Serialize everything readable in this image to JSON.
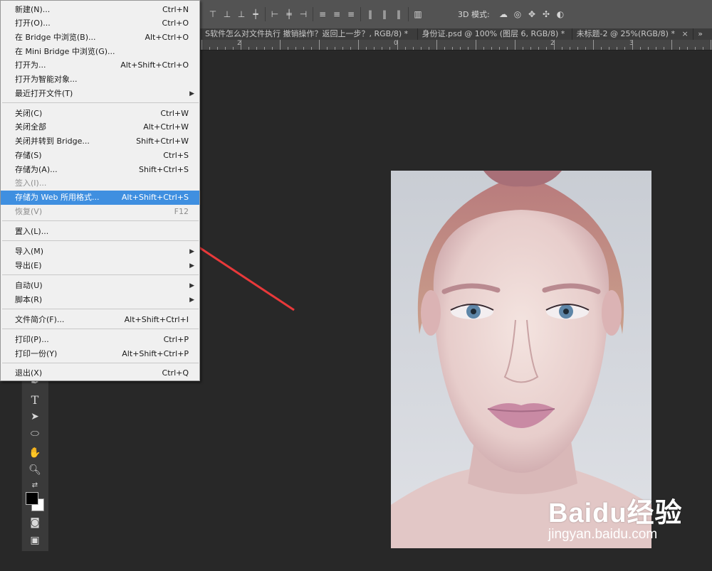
{
  "options_bar": {
    "label_3d": "3D 模式:"
  },
  "tabs": [
    {
      "label": "S软件怎么对文件执行 撤销操作？返回上一步？, RGB/8) *"
    },
    {
      "label": "身份证.psd @ 100% (图层 6, RGB/8) *"
    },
    {
      "label": "未标题-2 @ 25%(RGB/8) *"
    }
  ],
  "ruler": {
    "marks": [
      "2",
      "0",
      "2",
      "3"
    ]
  },
  "menu": {
    "items": [
      {
        "label": "新建(N)...",
        "shortcut": "Ctrl+N"
      },
      {
        "label": "打开(O)...",
        "shortcut": "Ctrl+O"
      },
      {
        "label": "在 Bridge 中浏览(B)...",
        "shortcut": "Alt+Ctrl+O"
      },
      {
        "label": "在 Mini Bridge 中浏览(G)...",
        "shortcut": ""
      },
      {
        "label": "打开为...",
        "shortcut": "Alt+Shift+Ctrl+O"
      },
      {
        "label": "打开为智能对象...",
        "shortcut": ""
      },
      {
        "label": "最近打开文件(T)",
        "shortcut": ""
      },
      {
        "label": "关闭(C)",
        "shortcut": "Ctrl+W"
      },
      {
        "label": "关闭全部",
        "shortcut": "Alt+Ctrl+W"
      },
      {
        "label": "关闭并转到 Bridge...",
        "shortcut": "Shift+Ctrl+W"
      },
      {
        "label": "存储(S)",
        "shortcut": "Ctrl+S"
      },
      {
        "label": "存储为(A)...",
        "shortcut": "Shift+Ctrl+S"
      },
      {
        "label": "签入(I)...",
        "shortcut": ""
      },
      {
        "label": "存储为 Web 所用格式...",
        "shortcut": "Alt+Shift+Ctrl+S"
      },
      {
        "label": "恢复(V)",
        "shortcut": "F12"
      },
      {
        "label": "置入(L)...",
        "shortcut": ""
      },
      {
        "label": "导入(M)",
        "shortcut": ""
      },
      {
        "label": "导出(E)",
        "shortcut": ""
      },
      {
        "label": "自动(U)",
        "shortcut": ""
      },
      {
        "label": "脚本(R)",
        "shortcut": ""
      },
      {
        "label": "文件简介(F)...",
        "shortcut": "Alt+Shift+Ctrl+I"
      },
      {
        "label": "打印(P)...",
        "shortcut": "Ctrl+P"
      },
      {
        "label": "打印一份(Y)",
        "shortcut": "Alt+Shift+Ctrl+P"
      },
      {
        "label": "退出(X)",
        "shortcut": "Ctrl+Q"
      }
    ]
  },
  "toolbar": {
    "type_tool_glyph": "T"
  },
  "watermark": {
    "logo": "Baidu经验",
    "url": "jingyan.baidu.com"
  },
  "colors": {
    "highlight": "#3f8fe0",
    "arrow": "#e8393a",
    "app_bg": "#282828"
  }
}
